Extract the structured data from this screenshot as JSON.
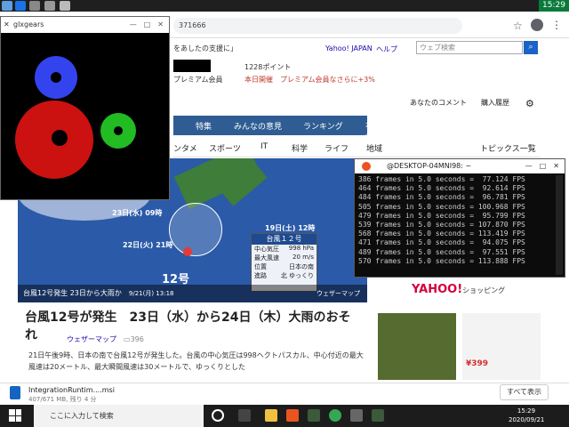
{
  "browser": {
    "address_partial": "371666",
    "support_text": "をあしたの支援に」",
    "yahoo_japan": "Yahoo! JAPAN",
    "help": "ヘルプ",
    "search_placeholder": "ウェブ検索",
    "points": "1228ポイント",
    "premium": "プレミアム会員",
    "honjitsu": "本日開催",
    "premium_offer": "プレミアム会員なさらに+3%"
  },
  "nav_primary": [
    "特集",
    "みんなの意見",
    "ランキング",
    "有料"
  ],
  "nav_secondary": [
    "ンタメ",
    "スポーツ",
    "IT",
    "科学",
    "ライフ",
    "地域"
  ],
  "right_menu": {
    "comments": "あなたのコメント",
    "history": "購入履歴",
    "topics": "トピックス一覧"
  },
  "hero": {
    "label_date1": "23日(水) 09時",
    "label_date2": "22日(火) 21時",
    "label_date3": "19日(土) 12時",
    "typhoon_num": "12号",
    "typhoon_box_title": "台風１２号",
    "rows": [
      {
        "k": "中心気圧",
        "v": "998 hPa"
      },
      {
        "k": "最大風速",
        "v": "20 m/s"
      },
      {
        "k": "位置",
        "v": "日本の南"
      },
      {
        "k": "進路",
        "v": "北 ゆっくり"
      }
    ],
    "caption": "台風12号発生 23日から大雨か",
    "caption_date": "9/21(月) 13:18",
    "weather_map": "ウェザーマップ"
  },
  "article": {
    "headline": "台風12号が発生　23日（水）から24日（木）大雨のおそれ",
    "source": "ウェザーマップ",
    "comments": "396",
    "body": "21日午後9時、日本の南で台風12号が発生した。台風の中心気圧は998ヘクトパスカル、中心付近の最大風速は20メートル、最大瞬間風速は30メートルで、ゆっくりとした"
  },
  "shopping": {
    "logo": "YAHOO!",
    "suffix": "ショッピング",
    "price": "¥399"
  },
  "glxgears": {
    "title": "glxgears"
  },
  "terminal": {
    "title": "@DESKTOP-04MNI98: ~",
    "lines": [
      "386 frames in 5.0 seconds =  77.124 FPS",
      "464 frames in 5.0 seconds =  92.614 FPS",
      "484 frames in 5.0 seconds =  96.781 FPS",
      "505 frames in 5.0 seconds = 100.968 FPS",
      "479 frames in 5.0 seconds =  95.799 FPS",
      "539 frames in 5.0 seconds = 107.870 FPS",
      "568 frames in 5.0 seconds = 113.419 FPS",
      "471 frames in 5.0 seconds =  94.075 FPS",
      "489 frames in 5.0 seconds =  97.551 FPS",
      "570 frames in 5.0 seconds = 113.888 FPS"
    ]
  },
  "download": {
    "name": "IntegrationRuntim....msi",
    "size": "407/671 MB, 残り 4 分",
    "show_all": "すべて表示"
  },
  "taskbar": {
    "search": "ここに入力して検索",
    "time": "15:29",
    "date": "2020/09/21",
    "top_time": "15:29"
  }
}
